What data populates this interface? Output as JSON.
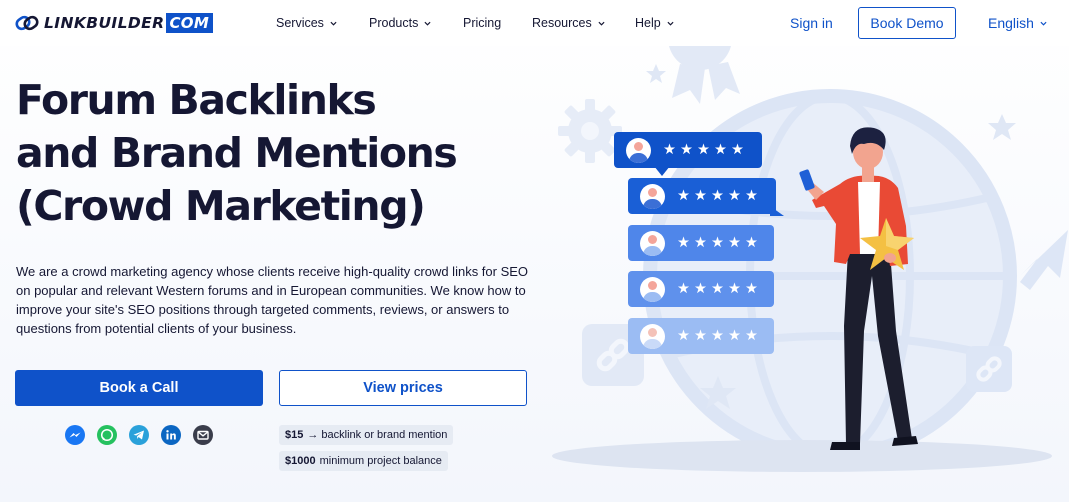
{
  "header": {
    "logo": {
      "brand": "LINKBUILDER",
      "suffix": "COM"
    },
    "nav": [
      {
        "label": "Services",
        "has_dropdown": true
      },
      {
        "label": "Products",
        "has_dropdown": true
      },
      {
        "label": "Pricing",
        "has_dropdown": false
      },
      {
        "label": "Resources",
        "has_dropdown": true
      },
      {
        "label": "Help",
        "has_dropdown": true
      }
    ],
    "sign_in": "Sign in",
    "book_demo": "Book Demo",
    "language": "English"
  },
  "hero": {
    "title_lines": [
      "Forum Backlinks",
      "and Brand Mentions",
      "(Crowd Marketing)"
    ],
    "description": "We are a crowd marketing agency whose clients receive high-quality crowd links for SEO on popular and relevant Western forums and in European communities. We know how to improve your site's SEO positions through targeted comments, reviews, or answers to questions from potential clients of your business.",
    "cta_primary": "Book a Call",
    "cta_secondary": "View prices",
    "price_notes": [
      {
        "value": "$15",
        "text": "→ backlink or brand mention"
      },
      {
        "value": "$1000",
        "text": "minimum project balance"
      }
    ]
  },
  "social_icons": [
    "messenger-icon",
    "whatsapp-icon",
    "telegram-icon",
    "linkedin-icon",
    "email-icon"
  ],
  "review_cards": [
    {
      "stars": "★★★★★"
    },
    {
      "stars": "★★★★★"
    },
    {
      "stars": "★★★★★"
    },
    {
      "stars": "★★★★★"
    },
    {
      "stars": "★★★★★"
    }
  ],
  "colors": {
    "primary": "#0f52c9",
    "text": "#151733",
    "card_colors": [
      "#0f52c9",
      "#1a5fd6",
      "#4f86ea",
      "#5f91ec",
      "#9bbcf3"
    ]
  }
}
